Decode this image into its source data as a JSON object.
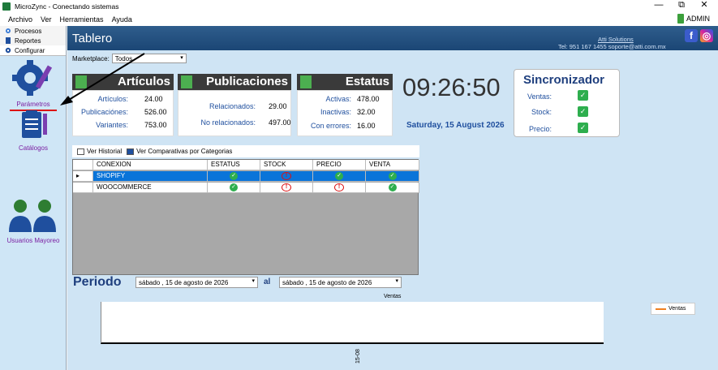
{
  "window": {
    "title": "MicroZync - Conectando sistemas",
    "minimize": "—",
    "restore": "⧉",
    "close": "✕"
  },
  "menu": {
    "items": [
      "Archivo",
      "Ver",
      "Herramientas",
      "Ayuda"
    ],
    "user": "ADMIN"
  },
  "sidebar": {
    "tabs": [
      "Procesos",
      "Reportes",
      "Configurar"
    ],
    "modules": [
      "Parámetros",
      "Catálogos",
      "Usuarios Mayoreo"
    ]
  },
  "header": {
    "title": "Tablero",
    "company": "Atti Solutions",
    "contact": "Tel: 951 167 1455  soporte@atti.com.mx",
    "facebook": "f",
    "instagram": "◎"
  },
  "marketplace": {
    "label": "Marketplace:",
    "value": "Todos"
  },
  "articulos": {
    "title": "Artículos",
    "rows": [
      {
        "label": "Artículos:",
        "value": "24.00"
      },
      {
        "label": "Publicaciónes:",
        "value": "526.00"
      },
      {
        "label": "Variantes:",
        "value": "753.00"
      }
    ]
  },
  "publicaciones": {
    "title": "Publicaciones",
    "rows": [
      {
        "label": "Relacionados:",
        "value": "29.00"
      },
      {
        "label": "No relacionados:",
        "value": "497.00"
      }
    ]
  },
  "estatus": {
    "title": "Estatus",
    "rows": [
      {
        "label": "Activas:",
        "value": "478.00"
      },
      {
        "label": "Inactivas:",
        "value": "32.00"
      },
      {
        "label": "Con errores:",
        "value": "16.00"
      }
    ]
  },
  "clock": {
    "time": "09:26:50",
    "date": "Saturday, 15 August 2026"
  },
  "sincronizador": {
    "title": "Sincronizador",
    "items": [
      "Ventas:",
      "Stock:",
      "Precio:"
    ]
  },
  "grid_toolbar": {
    "historial": "Ver Historial",
    "comparativas": "Ver Comparativas por Categorias"
  },
  "grid": {
    "columns": [
      "CONEXION",
      "ESTATUS",
      "STOCK",
      "PRECIO",
      "VENTA"
    ],
    "rows": [
      {
        "conexion": "SHOPIFY",
        "estatus": "ok",
        "stock": "warn",
        "precio": "ok",
        "venta": "ok"
      },
      {
        "conexion": "WOOCOMMERCE",
        "estatus": "ok",
        "stock": "warn",
        "precio": "warn",
        "venta": "ok"
      }
    ]
  },
  "periodo": {
    "title": "Periodo",
    "al": "al",
    "from": "sábado  , 15 de     agosto     de 2026",
    "to": "sábado  , 15 de     agosto     de 2026"
  },
  "chart_data": {
    "type": "line",
    "title": "Ventas",
    "x": [
      "15-08"
    ],
    "series": [
      {
        "name": "Ventas",
        "values": [
          0
        ]
      }
    ],
    "legend": "top-right",
    "color": "#f08020"
  },
  "colors": {
    "accent": "#1f4f9e",
    "header": "#1b4675",
    "selection": "#0a74d9",
    "ok": "#2eae4e",
    "warn": "#dd1111"
  }
}
